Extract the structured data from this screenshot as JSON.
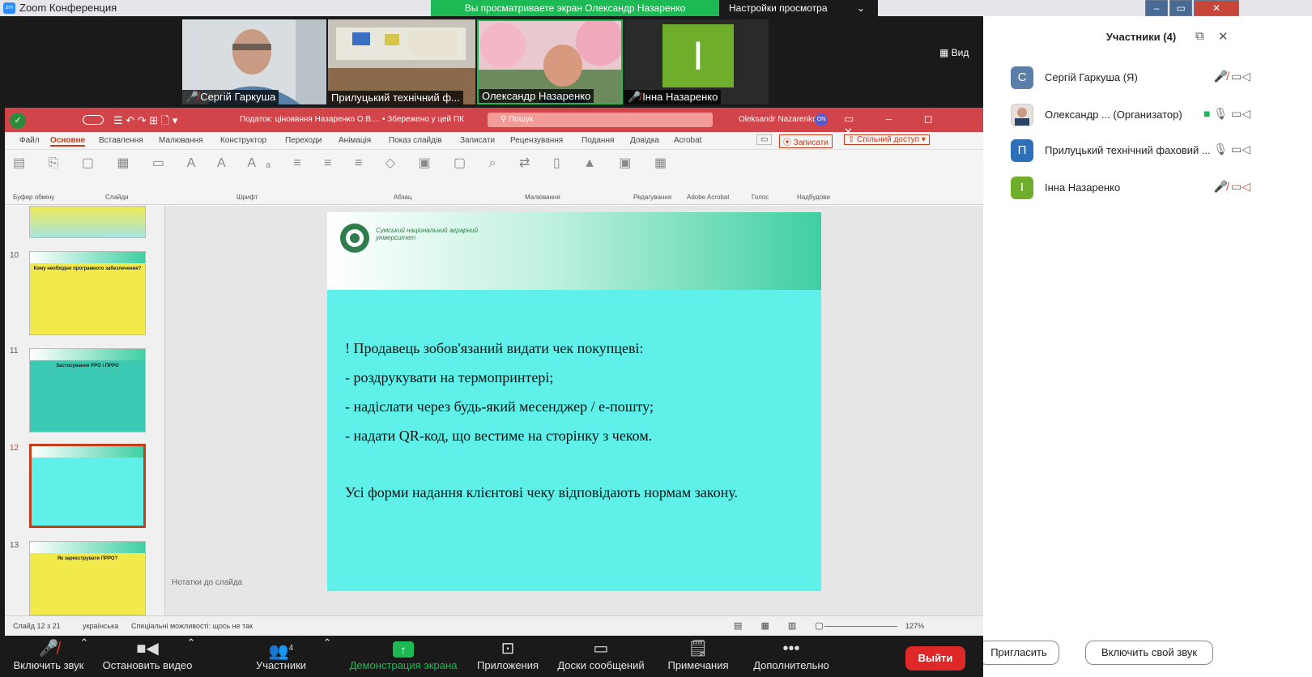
{
  "window": {
    "app_title": "Zoom Конференция"
  },
  "share_banner": {
    "text": "Вы просматриваете экран Олександр Назаренко",
    "view_settings": "Настройки просмотра"
  },
  "video_strip": {
    "view_label": "Вид",
    "tiles": [
      {
        "name": "Сергій Гаркуша"
      },
      {
        "name": "Прилуцький технічний ф..."
      },
      {
        "name": "Олександр Назаренко"
      },
      {
        "name": "Інна Назаренко",
        "initial": "І"
      }
    ]
  },
  "powerpoint": {
    "title_center": "Податок: ціноввння Назаренко О.В.... • Збережено у цей ПК",
    "search": "Пошук",
    "user": "Oleksandr Nazarenko",
    "ribbon_tabs": [
      "Файл",
      "Основне",
      "Вставлення",
      "Малювання",
      "Конструктор",
      "Переходи",
      "Анімація",
      "Показ слайдів",
      "Записати",
      "Рецензування",
      "Подання",
      "Довідка",
      "Acrobat"
    ],
    "record_btn": "Записати",
    "share_btn": "Спільний доступ",
    "ribbon_groups": [
      "Буфер обміну",
      "Слайди",
      "Шрифт",
      "Абзац",
      "Малювання",
      "Редагування",
      "Adobe Acrobat",
      "Голос",
      "Надбудови"
    ],
    "thumbnails": [
      {
        "num": "10",
        "title": "Кому необхідно програмного забезпечення?"
      },
      {
        "num": "11",
        "title": "Застосування РРО і ПРРО"
      },
      {
        "num": "12",
        "title": ""
      },
      {
        "num": "13",
        "title": "Як зареєструвати ПРРО?"
      }
    ],
    "notes": "Нотатки до слайда",
    "status_slide": "Слайд 12 з 21",
    "status_lang": "українська",
    "status_access": "Спеціальні можливості: щось не так",
    "zoom_level": "127%",
    "slide": {
      "header_text": "Сумський національний аграрний університет",
      "lines": [
        "! Продавець зобов'язаний видати чек покупцеві:",
        "- роздрукувати на термопринтері;",
        "- надіслати через будь-який месенджер / е-пошту;",
        "- надати QR-код, що вестиме на сторінку з чеком."
      ],
      "conclusion": "Усі форми надання клієнтові чеку відповідають нормам закону."
    }
  },
  "participants": {
    "title": "Участники (4)",
    "list": [
      {
        "initial": "С",
        "name": "Сергій Гаркуша (Я)",
        "color": "#5b7fa8"
      },
      {
        "initial": "",
        "name": "Олександр ...  (Организатор)",
        "color": "#dcdcdc"
      },
      {
        "initial": "П",
        "name": "Прилуцький технічний фаховий ...",
        "color": "#2d6fb8"
      },
      {
        "initial": "І",
        "name": "Інна Назаренко",
        "color": "#6fae2b"
      }
    ],
    "invite": "Пригласить",
    "unmute": "Включить свой звук"
  },
  "toolbar": {
    "unmute": "Включить звук",
    "stop_video": "Остановить видео",
    "participants": "Участники",
    "participants_count": "4",
    "share": "Демонстрация экрана",
    "apps": "Приложения",
    "whiteboards": "Доски сообщений",
    "notes": "Примечания",
    "more": "Дополнительно",
    "leave": "Выйти"
  }
}
